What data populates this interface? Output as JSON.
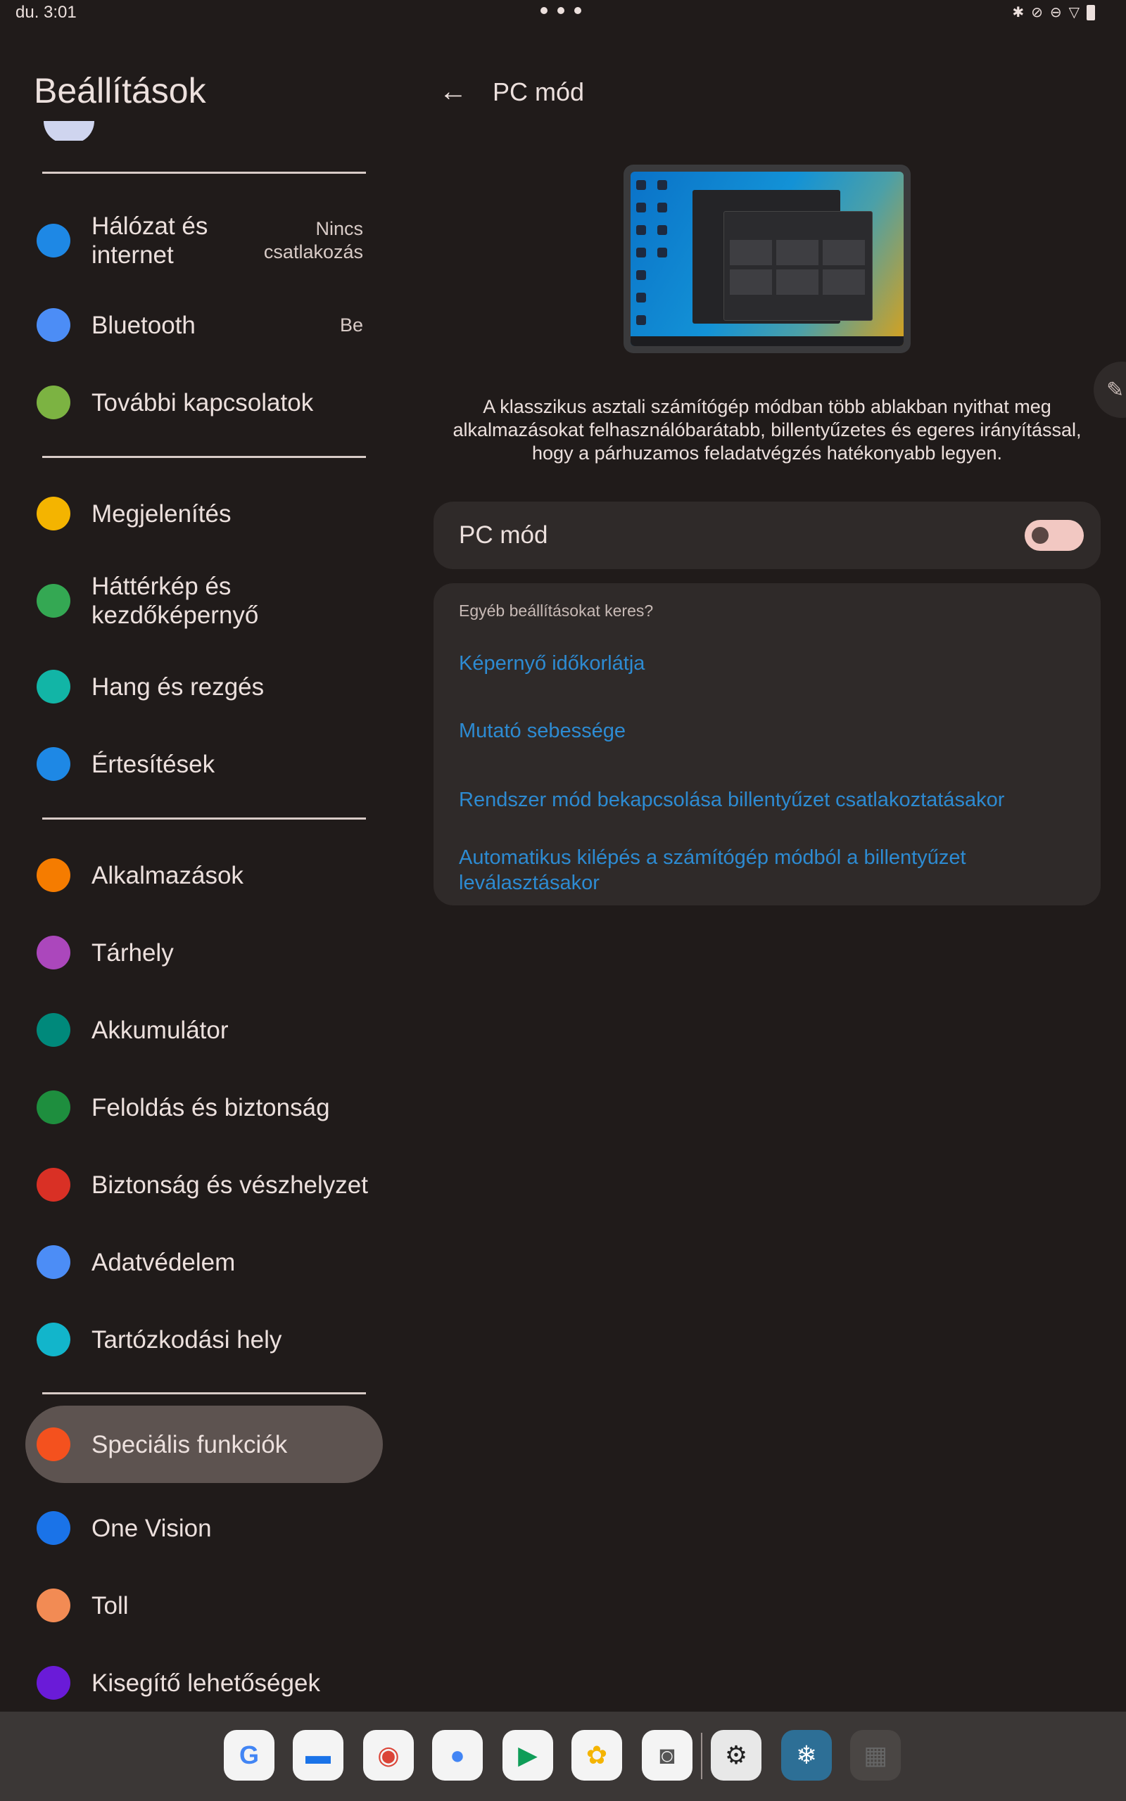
{
  "status": {
    "time": "du. 3:01"
  },
  "left": {
    "title": "Beállítások",
    "items": [
      {
        "label": "Hálózat és\ninternet",
        "summary": "Nincs\ncsatlakozás",
        "icon": "wifi-icon",
        "color": "#1e88e5"
      },
      {
        "label": "Bluetooth",
        "summary": "Be",
        "icon": "bluetooth-icon",
        "color": "#4c8df6"
      },
      {
        "label": "További kapcsolatok",
        "summary": "",
        "icon": "devices-icon",
        "color": "#7cb342"
      },
      {
        "label": "Megjelenítés",
        "summary": "",
        "icon": "brightness-icon",
        "color": "#f4b400"
      },
      {
        "label": "Háttérkép és\nkezdőképernyő",
        "summary": "",
        "icon": "wallpaper-icon",
        "color": "#34a853"
      },
      {
        "label": "Hang és rezgés",
        "summary": "",
        "icon": "volume-icon",
        "color": "#12b5a6"
      },
      {
        "label": "Értesítések",
        "summary": "",
        "icon": "bell-icon",
        "color": "#1e88e5"
      },
      {
        "label": "Alkalmazások",
        "summary": "",
        "icon": "apps-grid-icon",
        "color": "#f57c00"
      },
      {
        "label": "Tárhely",
        "summary": "",
        "icon": "storage-icon",
        "color": "#ab47bc"
      },
      {
        "label": "Akkumulátor",
        "summary": "",
        "icon": "battery-icon",
        "color": "#00897b"
      },
      {
        "label": "Feloldás és biztonság",
        "summary": "",
        "icon": "lock-icon",
        "color": "#1e8e3e"
      },
      {
        "label": "Biztonság és vészhelyzet",
        "summary": "",
        "icon": "emergency-icon",
        "color": "#d93025"
      },
      {
        "label": "Adatvédelem",
        "summary": "",
        "icon": "privacy-eye-icon",
        "color": "#4c8df6"
      },
      {
        "label": "Tartózkodási hely",
        "summary": "",
        "icon": "location-icon",
        "color": "#12b5cb"
      },
      {
        "label": "Speciális funkciók",
        "summary": "",
        "icon": "star-icon",
        "color": "#f4511e"
      },
      {
        "label": "One Vision",
        "summary": "",
        "icon": "one-vision-icon",
        "color": "#1a73e8"
      },
      {
        "label": "Toll",
        "summary": "",
        "icon": "pen-icon",
        "color": "#f28b54"
      },
      {
        "label": "Kisegítő lehetőségek",
        "summary": "",
        "icon": "accessibility-icon",
        "color": "#6a1bd8"
      }
    ]
  },
  "right": {
    "title": "PC mód",
    "description": "A klasszikus asztali számítógép módban több ablakban nyithat meg alkalmazásokat felhasználóbarátabb, billentyűzetes és egeres irányítással, hogy a párhuzamos feladatvégzés hatékonyabb legyen.",
    "toggle": {
      "label": "PC mód",
      "on": false
    },
    "links_heading": "Egyéb beállításokat keres?",
    "links": [
      "Képernyő időkorlátja",
      "Mutató sebessége",
      "Rendszer mód bekapcsolása billentyűzet csatlakoztatásakor",
      "Automatikus kilépés a számítógép módból a billentyűzet leválasztásakor"
    ]
  },
  "taskbar": {
    "apps": [
      {
        "name": "google-icon",
        "glyph": "G",
        "color": "#4285f4"
      },
      {
        "name": "messages-icon",
        "glyph": "▬",
        "color": "#1a73e8"
      },
      {
        "name": "chrome-icon",
        "glyph": "◉",
        "color": "#db4437"
      },
      {
        "name": "assistant-icon",
        "glyph": "●",
        "color": "#4285f4"
      },
      {
        "name": "play-store-icon",
        "glyph": "▶",
        "color": "#0f9d58"
      },
      {
        "name": "photos-icon",
        "glyph": "✿",
        "color": "#f4b400"
      },
      {
        "name": "camera-icon",
        "glyph": "◙",
        "color": "#555555"
      },
      {
        "name": "settings-gear-icon",
        "glyph": "⚙",
        "color": "#222222"
      },
      {
        "name": "snowflake-app-icon",
        "glyph": "❄",
        "color": "#ffffff"
      },
      {
        "name": "app-drawer-icon",
        "glyph": "▦",
        "color": "#666666"
      }
    ]
  }
}
